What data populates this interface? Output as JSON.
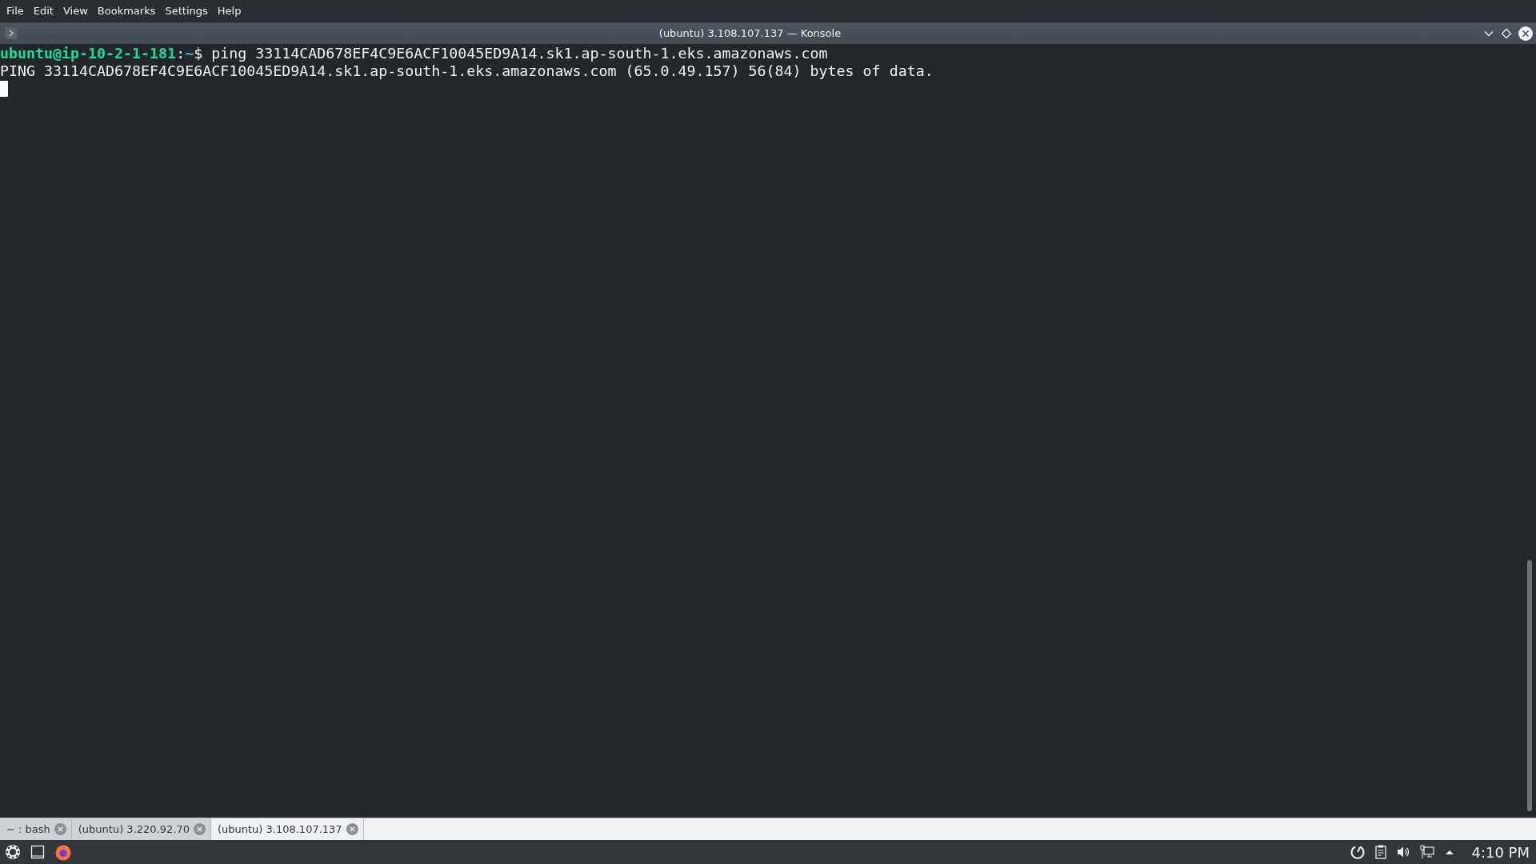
{
  "menu_bar": [
    "File",
    "Edit",
    "View",
    "Bookmarks",
    "Settings",
    "Help"
  ],
  "window": {
    "title": "(ubuntu) 3.108.107.137 — Konsole"
  },
  "terminal": {
    "lines": [
      {
        "kind": "prompt",
        "user_host": "ubuntu@ip-10-2-1-181",
        "separator": ":",
        "path": "~",
        "command": "$ ping 33114CAD678EF4C9E6ACF10045ED9A14.sk1.ap-south-1.eks.amazonaws.com"
      },
      {
        "kind": "output",
        "text": "PING 33114CAD678EF4C9E6ACF10045ED9A14.sk1.ap-south-1.eks.amazonaws.com (65.0.49.157) 56(84) bytes of data."
      }
    ]
  },
  "tabs": [
    {
      "label": "~ : bash",
      "selected": false
    },
    {
      "label": "(ubuntu) 3.220.92.70",
      "selected": false
    },
    {
      "label": "(ubuntu) 3.108.107.137",
      "selected": true
    }
  ],
  "taskbar": {
    "clock": "4:10 PM"
  }
}
